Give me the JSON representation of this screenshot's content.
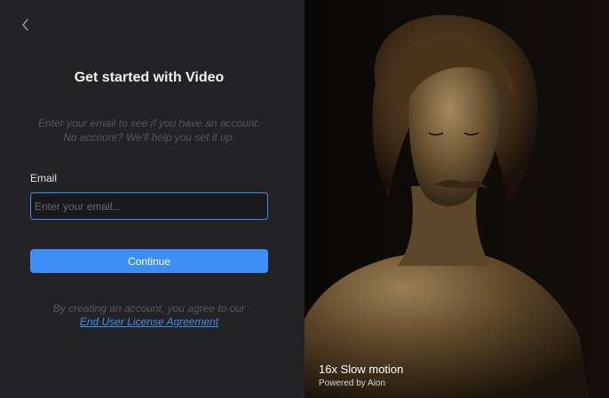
{
  "signup": {
    "title": "Get started with Video",
    "subtitle_line1": "Enter your email to see if you have an account.",
    "subtitle_line2": "No account? We'll help you set it up.",
    "email_label": "Email",
    "email_placeholder": "Enter your email...",
    "email_value": "",
    "continue_label": "Continue",
    "terms_text": "By creating an account, you agree to our",
    "terms_link": "End User License Agreement"
  },
  "promo": {
    "title": "16x Slow motion",
    "subtitle": "Powered by Aion"
  },
  "colors": {
    "accent": "#3d8ef5",
    "panel_bg": "#232325",
    "input_bg": "#19191b"
  },
  "icons": {
    "back": "chevron-left-icon"
  }
}
